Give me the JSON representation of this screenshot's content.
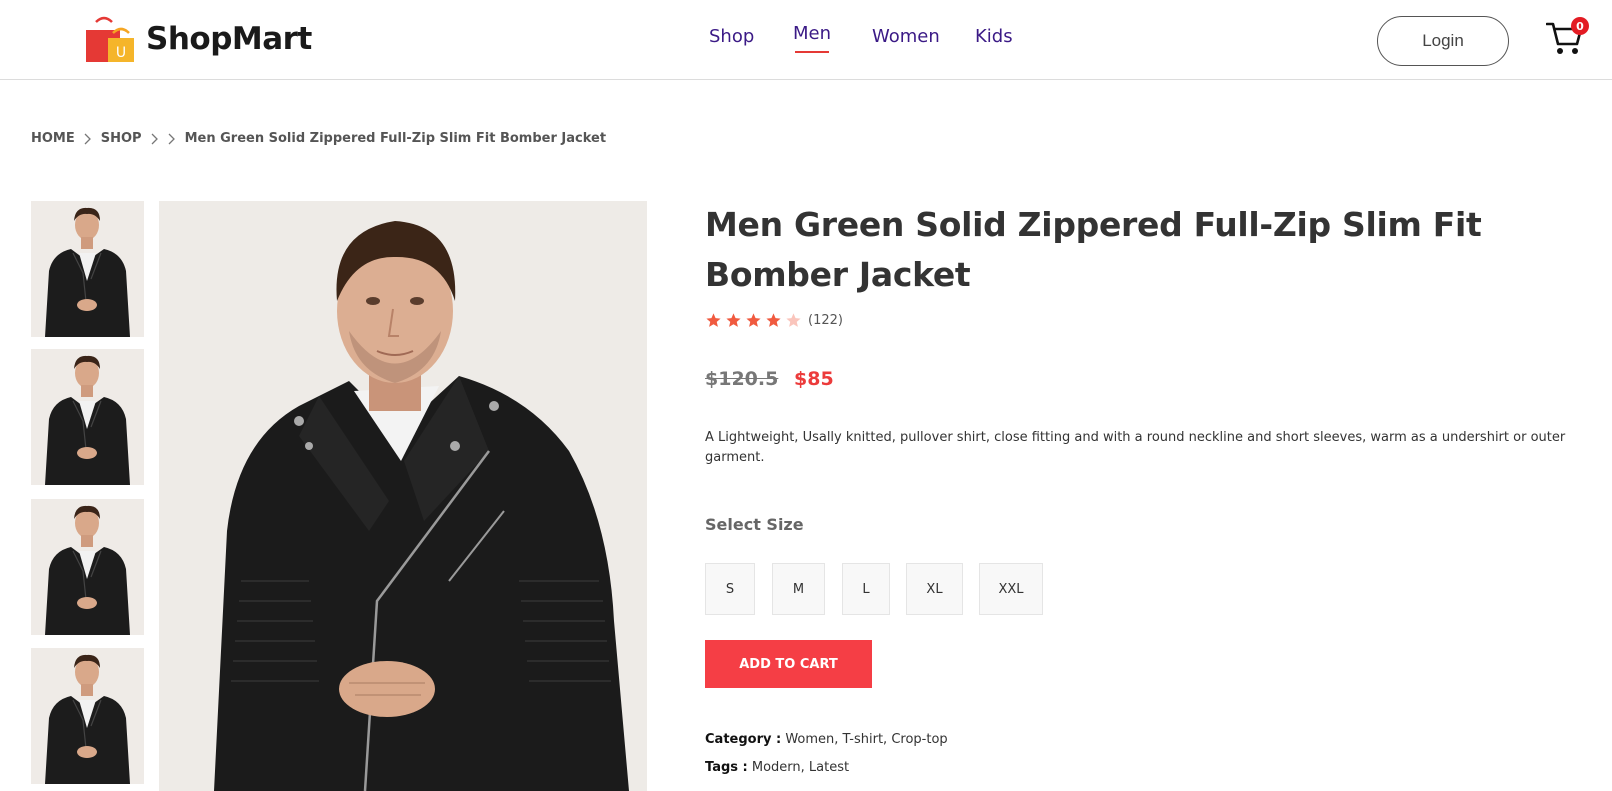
{
  "brand": {
    "name": "ShopMart",
    "icon": "shopping-bags-icon"
  },
  "nav": {
    "items": [
      "Shop",
      "Men",
      "Women",
      "Kids"
    ],
    "active": "Men"
  },
  "header": {
    "login_label": "Login",
    "cart_count": "0",
    "cart_icon": "cart-icon"
  },
  "breadcrumb": {
    "home": "HOME",
    "shop": "SHOP",
    "current": "Men Green Solid Zippered Full-Zip Slim Fit Bomber Jacket"
  },
  "product": {
    "title": "Men Green Solid Zippered Full-Zip Slim Fit Bomber Jacket",
    "rating": 4,
    "rating_max": 5,
    "review_count": "(122)",
    "old_price": "$120.5",
    "price": "$85",
    "description": "A Lightweight, Usally knitted, pullover shirt, close fitting and with a round neckline and short sleeves, warm as a undershirt or outer garment.",
    "size_label": "Select Size",
    "sizes": [
      "S",
      "M",
      "L",
      "XL",
      "XXL"
    ],
    "add_to_cart": "ADD TO CART",
    "category_label": "Category :",
    "categories": "Women, T-shirt, Crop-top",
    "tags_label": "Tags :",
    "tags": "Modern, Latest"
  },
  "colors": {
    "accent": "#f53e45",
    "nav": "#3b1a86",
    "price": "#ec3b3b",
    "star": "#f05a3f"
  }
}
